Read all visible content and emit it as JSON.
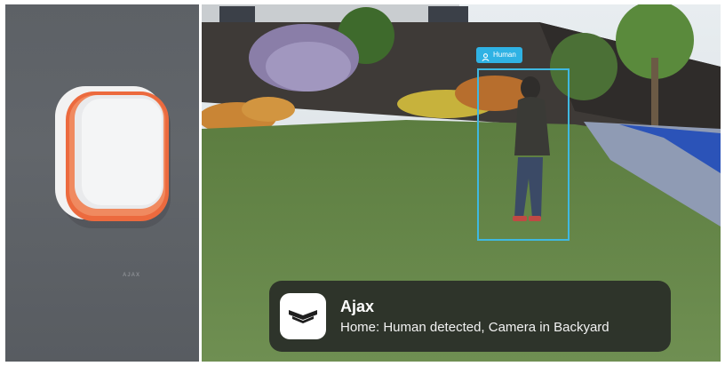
{
  "left_panel": {
    "device_brand": "AJAX"
  },
  "camera": {
    "detection_label": "Human",
    "detection_icon": "person-icon",
    "accent_color": "#3fb8e0"
  },
  "notification": {
    "app_icon": "ajax-logo-icon",
    "title": "Ajax",
    "message": "Home: Human detected, Camera in Backyard"
  }
}
